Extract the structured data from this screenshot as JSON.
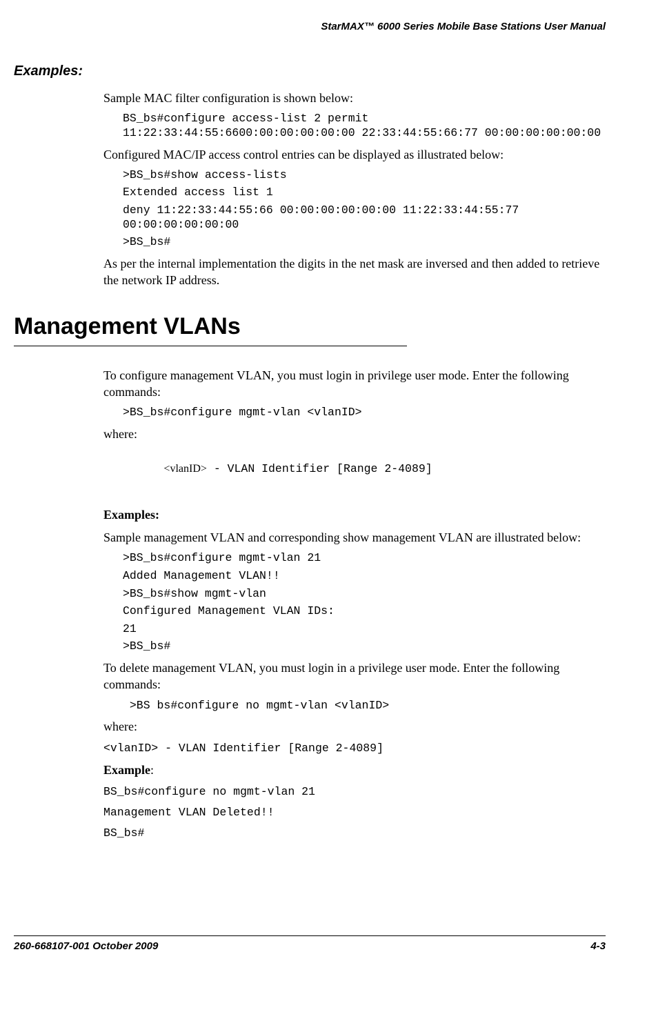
{
  "header": {
    "title": "StarMAX™ 6000 Series Mobile Base Stations User Manual"
  },
  "section1": {
    "heading": "Examples:",
    "intro": "Sample MAC filter configuration is shown below:",
    "code1": "BS_bs#configure access-list 2 permit 11:22:33:44:55:6600:00:00:00:00:00 22:33:44:55:66:77 00:00:00:00:00:00",
    "para2": "Configured MAC/IP access control entries can be displayed as illustrated below:",
    "code2_l1": ">BS_bs#show access-lists",
    "code2_l2": "Extended access list 1",
    "code2_l3": "deny 11:22:33:44:55:66 00:00:00:00:00:00 11:22:33:44:55:77 00:00:00:00:00:00",
    "code2_l4": ">BS_bs#",
    "para3": "As per the internal implementation the digits in the net mask are inversed and then added to retrieve the network IP address."
  },
  "section2": {
    "title": "Management VLANs",
    "intro": "To configure management VLAN, you must login in privilege user mode. Enter the following commands:",
    "code1": ">BS_bs#configure mgmt-vlan <vlanID>",
    "where": "where:",
    "param_name": "<vlanID>",
    "param_desc": "- VLAN Identifier [Range 2-4089]",
    "examples_heading": "Examples:",
    "examples_intro": "Sample management VLAN and corresponding show management VLAN are illustrated below:",
    "ex_l1": ">BS_bs#configure mgmt-vlan 21",
    "ex_l2": "Added Management VLAN!!",
    "ex_l3": ">BS_bs#show mgmt-vlan",
    "ex_l4": "Configured Management VLAN IDs:",
    "ex_l5": "21",
    "ex_l6": ">BS_bs#",
    "delete_intro": "To delete management VLAN, you must login in a privilege user mode. Enter the following commands:",
    "delete_code": " >BS bs#configure no mgmt-vlan <vlanID>",
    "where2": "where:",
    "param2": "<vlanID> - VLAN Identifier [Range 2-4089]",
    "example_heading": "Example",
    "example_colon": ":",
    "final_l1": "BS_bs#configure no mgmt-vlan 21",
    "final_l2": "Management VLAN Deleted!!",
    "final_l3": "BS_bs#"
  },
  "footer": {
    "left": "260-668107-001 October 2009",
    "right": "4-3"
  }
}
